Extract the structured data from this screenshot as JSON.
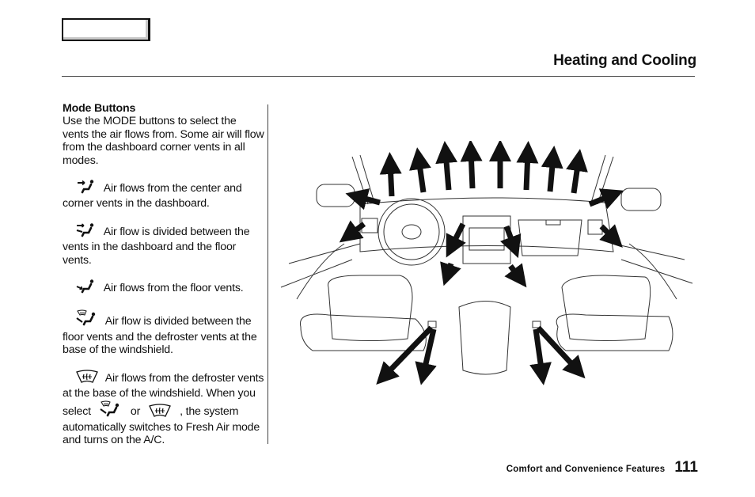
{
  "header": {
    "title": "Heating and Cooling"
  },
  "section": {
    "title": "Mode Buttons",
    "intro": "Use the MODE buttons to select the vents the air flows from. Some air will flow from the dashboard corner vents in all modes."
  },
  "modes": [
    {
      "icon": "dashboard-vent-mode-icon",
      "text": "Air flows from the center and corner vents in the dashboard."
    },
    {
      "icon": "bi-level-mode-icon",
      "text": "Air flow is divided between the vents in the dashboard and the floor vents."
    },
    {
      "icon": "floor-vent-mode-icon",
      "text": "Air flows from the floor vents."
    },
    {
      "icon": "floor-defrost-mode-icon",
      "text": "Air flow is divided between the floor vents and the defroster vents at the base of the windshield."
    },
    {
      "icon": "defrost-mode-icon",
      "text": "Air flows from the defroster vents at the base of the windshield."
    }
  ],
  "note": {
    "part1": "When you select",
    "or": "or",
    "comma": ",",
    "part2": "the system automatically switches to Fresh Air mode and turns on the A/C."
  },
  "illustration": {
    "subject": "Car interior airflow diagram with arrows showing vent airflow directions"
  },
  "footer": {
    "section": "Comfort and Convenience Features",
    "page_number": "111"
  }
}
